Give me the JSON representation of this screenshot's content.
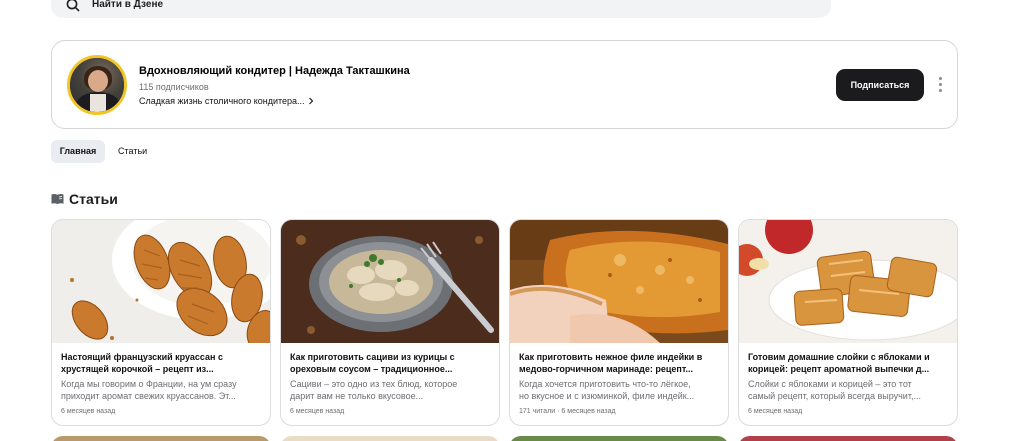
{
  "search": {
    "placeholder": "Найти в Дзене",
    "icon": "search-icon"
  },
  "channel": {
    "name": "Вдохновляющий кондитер | Надежда Такташкина",
    "subscribers": "115 подписчиков",
    "description": "Сладкая жизнь столичного кондитера...",
    "subscribe_label": "Подписаться",
    "accent_color": "#f0c529"
  },
  "tabs": [
    {
      "label": "Главная",
      "active": true
    },
    {
      "label": "Статьи",
      "active": false
    }
  ],
  "section": {
    "title": "Статьи",
    "icon": "book-icon"
  },
  "articles": [
    {
      "title": "Настоящий французский круассан с\nхрустящей корочкой – рецепт из...",
      "desc": "Когда мы говорим о Франции, на ум сразу\nприходит аромат свежих круассанов. Эт...",
      "meta": "6 месяцев назад",
      "image": "croissants-photo"
    },
    {
      "title": "Как приготовить сациви из курицы с\nореховым соусом – традиционное...",
      "desc": "Сациви – это одно из тех блюд, которое\nдарит вам не только вкусовое...",
      "meta": "6 месяцев назад",
      "image": "satsivi-photo"
    },
    {
      "title": "Как приготовить нежное филе индейки в\nмедово-горчичном маринаде: рецепт...",
      "desc": "Когда хочется приготовить что-то лёгкое,\nно вкусное и с изюминкой, филе индейк...",
      "meta": "171 читали · 6 месяцев назад",
      "image": "turkey-fillet-photo"
    },
    {
      "title": "Готовим домашние слойки с яблоками и\nкорицей: рецепт ароматной выпечки д...",
      "desc": "Слойки с яблоками и корицей – это тот\nсамый рецепт, который всегда выручит,...",
      "meta": "6 месяцев назад",
      "image": "apple-puffs-photo"
    }
  ]
}
